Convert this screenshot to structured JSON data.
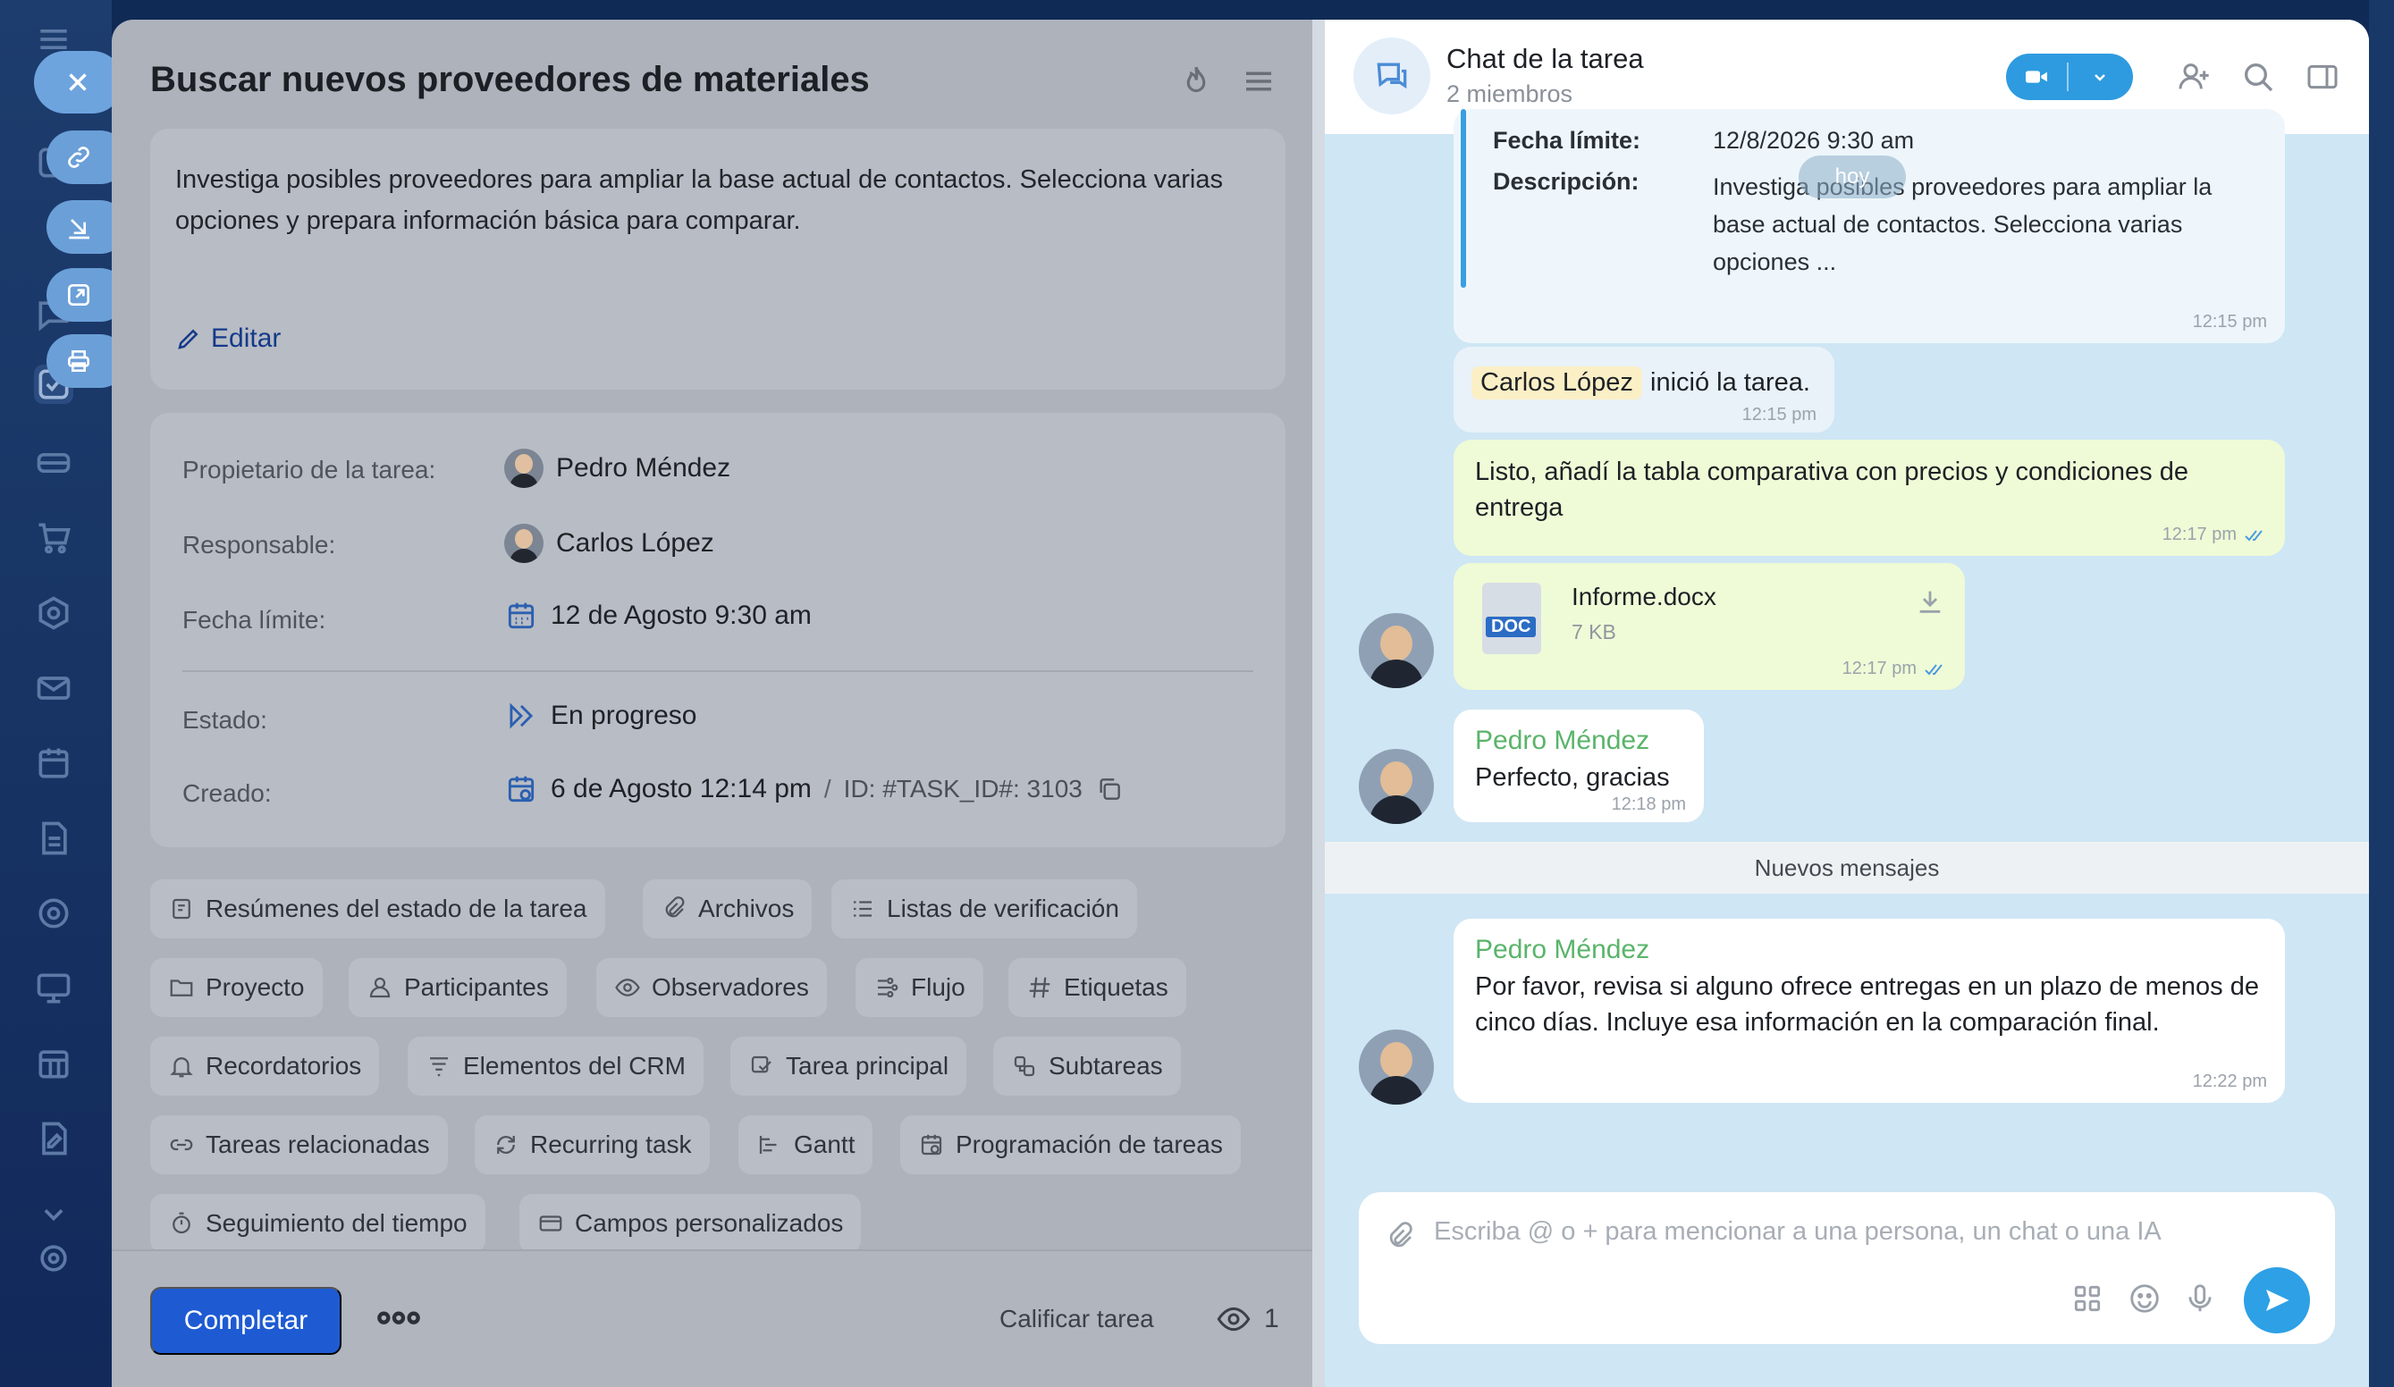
{
  "task": {
    "title": "Buscar nuevos proveedores de materiales",
    "description": "Investiga posibles proveedores para ampliar la base actual de contactos. Selecciona varias opciones y prepara información básica para comparar.",
    "edit_label": "Editar",
    "fields": {
      "owner_label": "Propietario de la tarea:",
      "owner_value": "Pedro Méndez",
      "responsible_label": "Responsable:",
      "responsible_value": "Carlos López",
      "deadline_label": "Fecha límite:",
      "deadline_value": "12 de Agosto 9:30 am",
      "status_label": "Estado:",
      "status_value": "En progreso",
      "created_label": "Creado:",
      "created_value": "6 de Agosto 12:14 pm",
      "separator": "/",
      "id_text": "ID: #TASK_ID#: 3103"
    },
    "chips": [
      "Resúmenes del estado de la tarea",
      "Archivos",
      "Listas de verificación",
      "Proyecto",
      "Participantes",
      "Observadores",
      "Flujo",
      "Etiquetas",
      "Recordatorios",
      "Elementos del CRM",
      "Tarea principal",
      "Subtareas",
      "Tareas relacionadas",
      "Recurring task",
      "Gantt",
      "Programación de tareas",
      "Seguimiento del tiempo",
      "Campos personalizados"
    ],
    "footer": {
      "complete_label": "Completar",
      "rate_label": "Calificar tarea",
      "views_count": "1"
    }
  },
  "chat": {
    "title": "Chat de la tarea",
    "subtitle": "2 miembros",
    "date_pill": "hoy",
    "system_card": {
      "deadline_label": "Fecha límite:",
      "deadline_value": "12/8/2026 9:30 am",
      "desc_label": "Descripción:",
      "desc_value": "Investiga posibles proveedores para ampliar la base actual de contactos. Selecciona varias opciones ...",
      "time": "12:15 pm"
    },
    "started": {
      "name": "Carlos López",
      "text": "inició la tarea.",
      "time": "12:15 pm"
    },
    "messages": [
      {
        "text": "Listo, añadí la tabla comparativa con precios y condiciones de entrega",
        "time": "12:17 pm"
      },
      {
        "file_name": "Informe.docx",
        "file_size": "7 KB",
        "file_badge": "DOC",
        "time": "12:17 pm"
      },
      {
        "sender": "Pedro Méndez",
        "text": "Perfecto, gracias",
        "time": "12:18 pm"
      },
      {
        "sender": "Pedro Méndez",
        "text": "Por favor, revisa si alguno ofrece entregas en un plazo de menos de cinco días. Incluye esa información en la comparación final.",
        "time": "12:22 pm"
      }
    ],
    "new_messages_label": "Nuevos mensajes",
    "composer_placeholder": "Escriba @ o + para mencionar a una persona, un chat o una IA"
  }
}
